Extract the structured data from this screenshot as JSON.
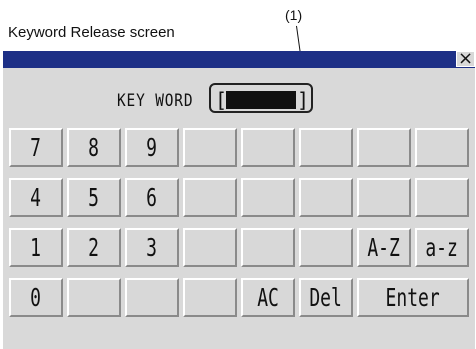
{
  "caption": "Keyword Release screen",
  "callout_label": "(1)",
  "window": {
    "close_icon": "×",
    "keyword_label": "KEY WORD",
    "bracket_open": "[",
    "bracket_close": "]"
  },
  "keypad": {
    "rows": [
      [
        "7",
        "8",
        "9",
        "",
        "",
        "",
        "",
        ""
      ],
      [
        "4",
        "5",
        "6",
        "",
        "",
        "",
        "",
        ""
      ],
      [
        "1",
        "2",
        "3",
        "",
        "",
        "",
        "A-Z",
        "a-z"
      ],
      [
        "0",
        "",
        "",
        "",
        "AC",
        "Del",
        "Enter",
        ""
      ]
    ]
  }
}
